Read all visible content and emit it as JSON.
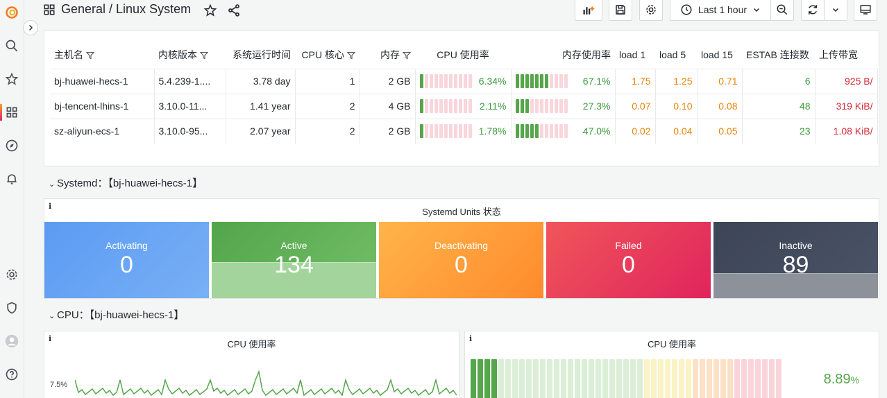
{
  "header": {
    "breadcrumb": "General  / Linux System",
    "time_range": "Last 1 hour"
  },
  "table": {
    "columns": [
      "主机名",
      "内核版本",
      "系统运行时间",
      "CPU 核心",
      "内存",
      "CPU 使用率",
      "内存使用率",
      "load 1",
      "load 5",
      "load 15",
      "ESTAB 连接数",
      "上传带宽"
    ],
    "rows": [
      {
        "host": "bj-huawei-hecs-1",
        "kernel": "5.4.239-1....",
        "uptime": "3.78 day",
        "cores": "1",
        "mem": "2 GB",
        "cpu": "6.34%",
        "cpu_frac": 0.0634,
        "memuse": "67.1%",
        "mem_frac": 0.671,
        "load1": "1.75",
        "load5": "1.25",
        "load15": "0.71",
        "estab": "6",
        "upload": "925 B/"
      },
      {
        "host": "bj-tencent-lhins-1",
        "kernel": "3.10.0-11...",
        "uptime": "1.41 year",
        "cores": "2",
        "mem": "4 GB",
        "cpu": "2.11%",
        "cpu_frac": 0.0211,
        "memuse": "27.3%",
        "mem_frac": 0.273,
        "load1": "0.07",
        "load5": "0.10",
        "load15": "0.08",
        "estab": "48",
        "upload": "319 KiB/"
      },
      {
        "host": "sz-aliyun-ecs-1",
        "kernel": "3.10.0-95...",
        "uptime": "2.07 year",
        "cores": "2",
        "mem": "2 GB",
        "cpu": "1.78%",
        "cpu_frac": 0.0178,
        "memuse": "47.0%",
        "mem_frac": 0.47,
        "load1": "0.02",
        "load5": "0.04",
        "load15": "0.05",
        "estab": "23",
        "upload": "1.08 KiB/"
      }
    ]
  },
  "systemd_row": {
    "title": "Systemd：【bj-huawei-hecs-1】"
  },
  "systemd_panel": {
    "info": "i",
    "title": "Systemd Units 状态",
    "stats": [
      {
        "label": "Activating",
        "value": "0"
      },
      {
        "label": "Active",
        "value": "134"
      },
      {
        "label": "Deactivating",
        "value": "0"
      },
      {
        "label": "Failed",
        "value": "0"
      },
      {
        "label": "Inactive",
        "value": "89"
      }
    ]
  },
  "cpu_row": {
    "title": "CPU：【bj-huawei-hecs-1】"
  },
  "cpu_chart": {
    "info": "i",
    "title": "CPU 使用率",
    "y_tick": "7.5%"
  },
  "cpu_gauge": {
    "info": "i",
    "title": "CPU 使用率",
    "value": "8.89",
    "unit": "%",
    "fraction": 0.0889
  },
  "colors": {
    "green": "#56a64b",
    "orange": "#e8840c",
    "red": "#d52c3a"
  }
}
